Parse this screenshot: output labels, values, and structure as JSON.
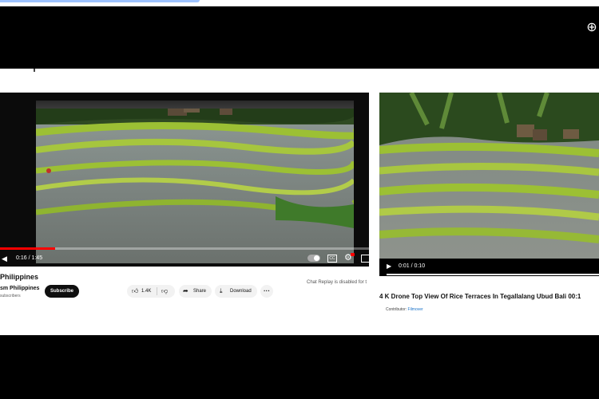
{
  "left_player": {
    "time": "0:16 / 1:45",
    "progress": 0.15
  },
  "video_info": {
    "title": "Philippines",
    "channel": "sm Philippines",
    "subscribers": "subscribers",
    "subscribe_label": "Subscribe",
    "likes": "1.4K",
    "share_label": "Share",
    "download_label": "Download",
    "more_label": "···",
    "chat_disabled": "Chat Replay is disabled for t"
  },
  "right_player": {
    "time": "0:01 / 0:10",
    "title": "4 K Drone Top View Of Rice Terraces In Tegallalang Ubud Bali 00:1",
    "contributor_label": "Contributor:",
    "contributor_name": "Filmover"
  },
  "icons": {
    "zoom": "zoom-in-icon",
    "volume": "volume-icon",
    "settings": "gear-icon",
    "like": "thumbs-up-icon",
    "dislike": "thumbs-down-icon",
    "share": "share-icon",
    "download": "download-icon",
    "play": "play-icon"
  },
  "colors": {
    "progress_red": "#ff0000",
    "subscribe_bg": "#0f0f0f",
    "link_blue": "#1b73c9",
    "terrace_green": "#9cc034"
  }
}
